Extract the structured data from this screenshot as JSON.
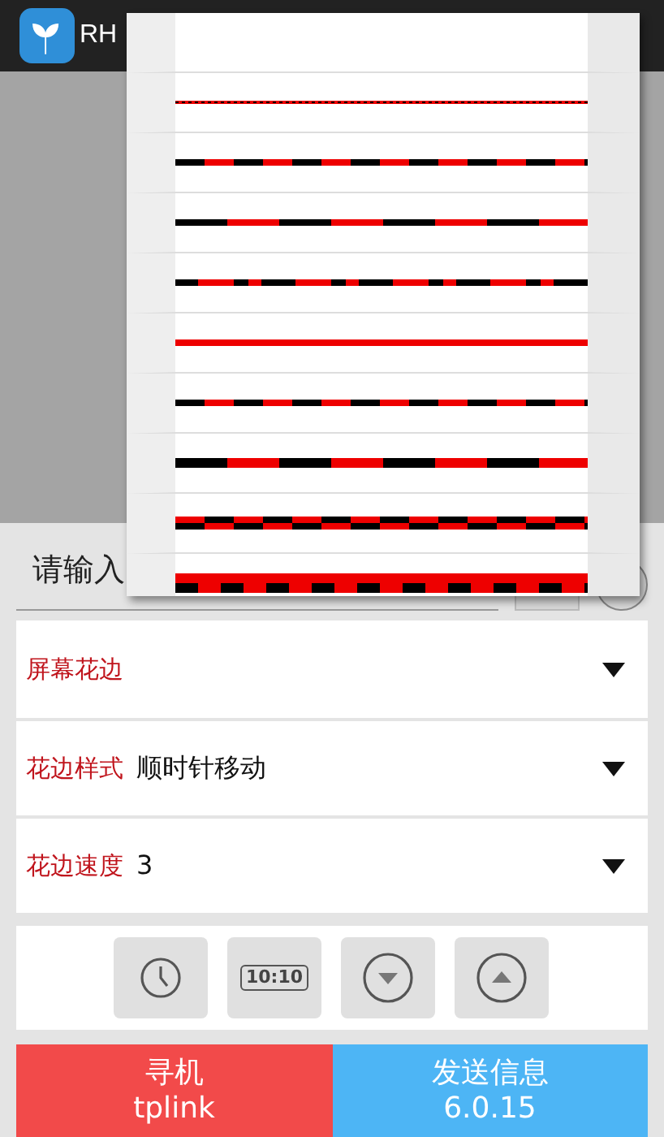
{
  "app_bar": {
    "title": "RH"
  },
  "text_input": {
    "placeholder": "请输入"
  },
  "settings": [
    {
      "kind": "header",
      "label": "屏幕花边"
    },
    {
      "kind": "value",
      "label": "花边样式",
      "value": "顺时针移动"
    },
    {
      "kind": "value",
      "label": "花边速度",
      "value": "3"
    }
  ],
  "tool_buttons": [
    {
      "kind": "clock"
    },
    {
      "kind": "digital-clock",
      "label": "10:10"
    },
    {
      "kind": "down"
    },
    {
      "kind": "up"
    }
  ],
  "bottom_buttons": [
    {
      "kind": "search",
      "title": "寻机",
      "subtitle": "tplink"
    },
    {
      "kind": "send",
      "title": "发送信息",
      "subtitle": "6.0.15"
    }
  ],
  "border_style_menu": [
    {
      "kind": "none"
    },
    {
      "kind": "fine"
    },
    {
      "kind": "dash-short"
    },
    {
      "kind": "dash-long"
    },
    {
      "kind": "mixed"
    },
    {
      "kind": "solid"
    },
    {
      "kind": "dash-short"
    },
    {
      "kind": "dash-long-thick"
    },
    {
      "kind": "checker"
    },
    {
      "kind": "checker-thick"
    }
  ]
}
